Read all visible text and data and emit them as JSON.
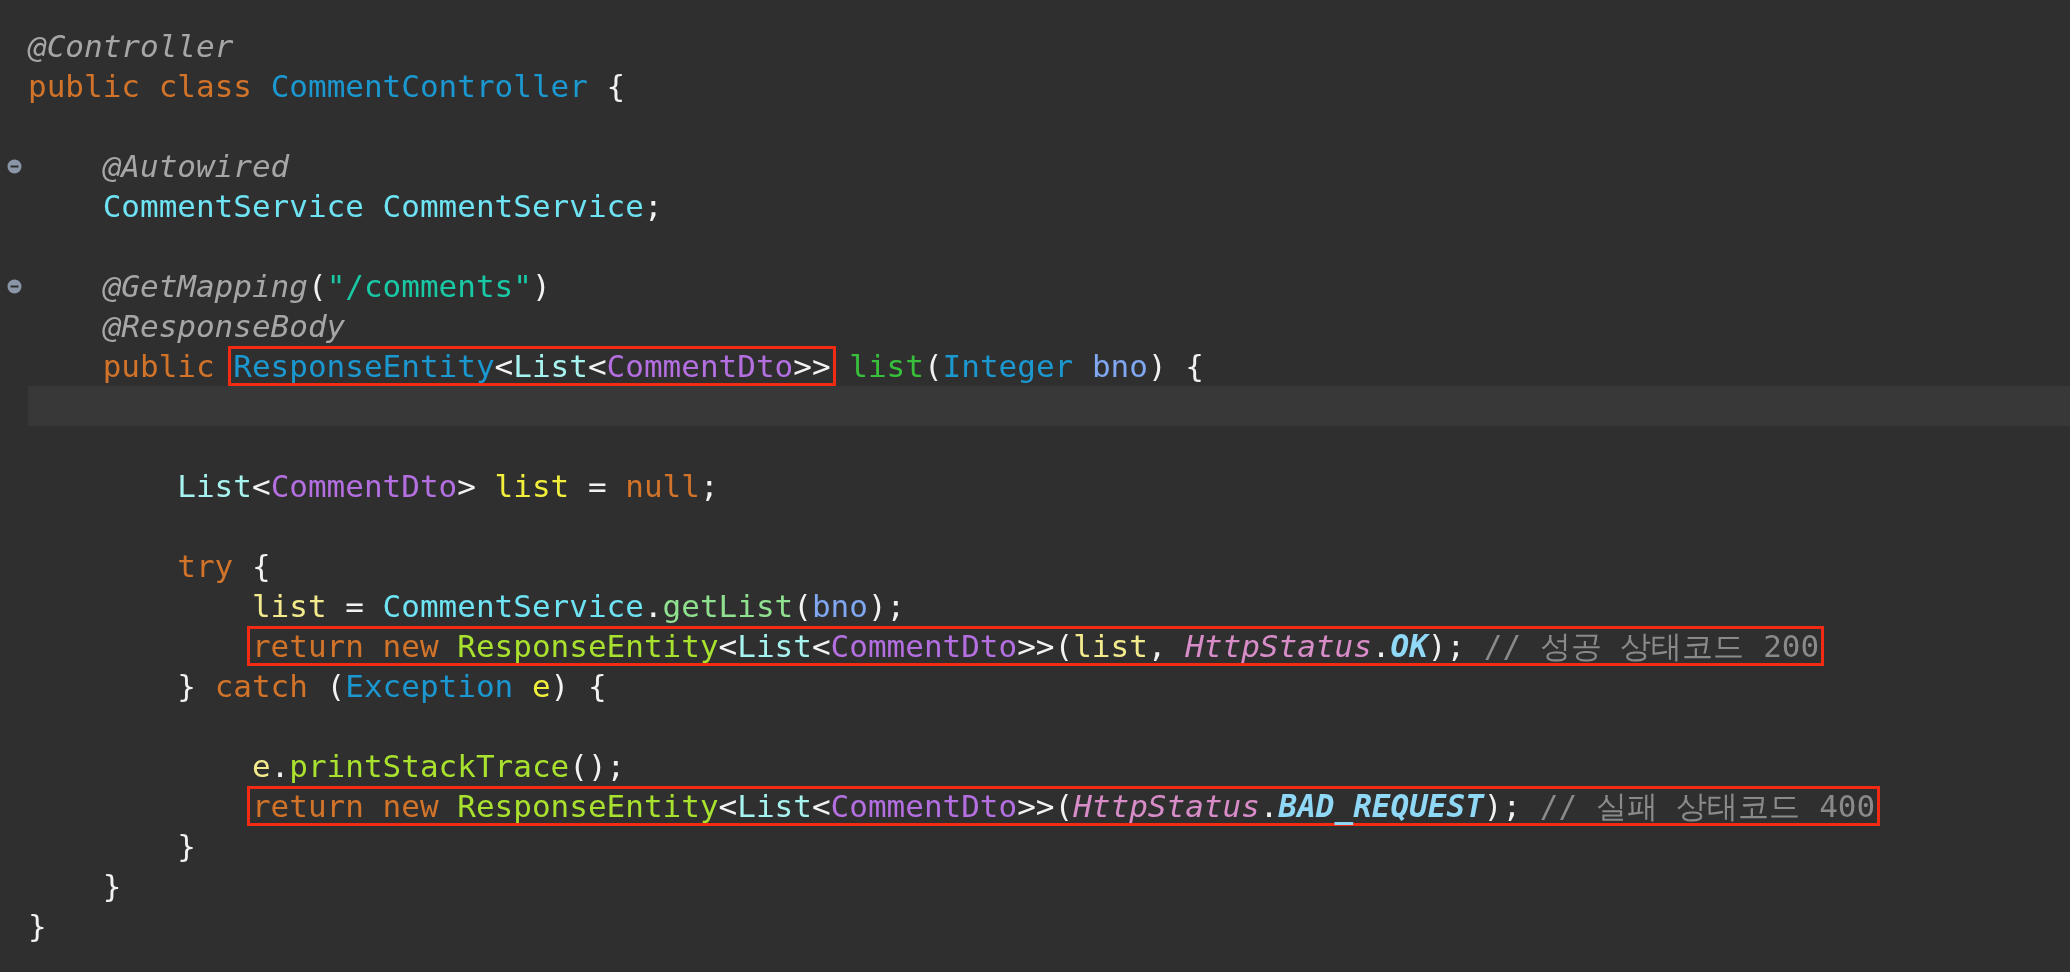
{
  "editor": {
    "lines": [
      {
        "kind": "code",
        "tokens": [
          {
            "kind": "annotation",
            "text": "@Controller"
          }
        ]
      },
      {
        "kind": "code",
        "tokens": [
          {
            "kind": "keyword",
            "text": "public class "
          },
          {
            "kind": "class",
            "text": "CommentController"
          },
          {
            "kind": "plain",
            "text": " {"
          }
        ],
        "children": [
          {
            "kind": "blank"
          },
          {
            "kind": "code",
            "folding": true,
            "tokens": [
              {
                "kind": "annotation",
                "text": "@Autowired"
              }
            ]
          },
          {
            "kind": "code",
            "tokens": [
              {
                "kind": "field_type",
                "text": "CommentService CommentService"
              },
              {
                "kind": "plain",
                "text": ";"
              }
            ]
          },
          {
            "kind": "blank"
          },
          {
            "kind": "code",
            "folding": true,
            "tokens": [
              {
                "kind": "annotation",
                "text": "@GetMapping"
              },
              {
                "kind": "plain",
                "text": "("
              },
              {
                "kind": "string",
                "text": "\"/comments\""
              },
              {
                "kind": "plain",
                "text": ")"
              }
            ]
          },
          {
            "kind": "code",
            "tokens": [
              {
                "kind": "annotation",
                "text": "@ResponseBody"
              }
            ]
          },
          {
            "kind": "code",
            "tokens": [
              {
                "kind": "keyword",
                "text": "public "
              },
              {
                "kind": "marked",
                "tokens": [
                  {
                    "kind": "class",
                    "text": "ResponseEntity"
                  },
                  {
                    "kind": "plain",
                    "text": "<"
                  },
                  {
                    "kind": "type",
                    "text": "List"
                  },
                  {
                    "kind": "plain",
                    "text": "<"
                  },
                  {
                    "kind": "dto",
                    "text": "CommentDto"
                  },
                  {
                    "kind": "plain",
                    "text": ">>"
                  }
                ]
              },
              {
                "kind": "method_decl",
                "text": " list"
              },
              {
                "kind": "plain",
                "text": "("
              },
              {
                "kind": "class",
                "text": "Integer "
              },
              {
                "kind": "param",
                "text": "bno"
              },
              {
                "kind": "plain",
                "text": ") {"
              }
            ],
            "children": [
              {
                "kind": "blank",
                "current": true
              },
              {
                "kind": "blank"
              },
              {
                "kind": "code",
                "tokens": [
                  {
                    "kind": "type",
                    "text": "List"
                  },
                  {
                    "kind": "plain",
                    "text": "<"
                  },
                  {
                    "kind": "dto",
                    "text": "CommentDto"
                  },
                  {
                    "kind": "plain",
                    "text": "> "
                  },
                  {
                    "kind": "var",
                    "text": "list"
                  },
                  {
                    "kind": "plain",
                    "text": " = "
                  },
                  {
                    "kind": "keyword",
                    "text": "null"
                  },
                  {
                    "kind": "plain",
                    "text": ";"
                  }
                ]
              },
              {
                "kind": "blank"
              },
              {
                "kind": "code",
                "tokens": [
                  {
                    "kind": "keyword",
                    "text": "try"
                  },
                  {
                    "kind": "plain",
                    "text": " {"
                  }
                ],
                "children": [
                  {
                    "kind": "code",
                    "tokens": [
                      {
                        "kind": "local",
                        "text": "list"
                      },
                      {
                        "kind": "plain",
                        "text": " = "
                      },
                      {
                        "kind": "field_type",
                        "text": "CommentService"
                      },
                      {
                        "kind": "plain",
                        "text": "."
                      },
                      {
                        "kind": "method",
                        "text": "getList"
                      },
                      {
                        "kind": "plain",
                        "text": "("
                      },
                      {
                        "kind": "param",
                        "text": "bno"
                      },
                      {
                        "kind": "plain",
                        "text": ");"
                      }
                    ]
                  },
                  {
                    "kind": "code",
                    "tokens": [
                      {
                        "kind": "marked",
                        "tokens": [
                          {
                            "kind": "keyword",
                            "text": "return new "
                          },
                          {
                            "kind": "call",
                            "text": "ResponseEntity"
                          },
                          {
                            "kind": "plain",
                            "text": "<"
                          },
                          {
                            "kind": "type",
                            "text": "List"
                          },
                          {
                            "kind": "plain",
                            "text": "<"
                          },
                          {
                            "kind": "dto",
                            "text": "CommentDto"
                          },
                          {
                            "kind": "plain",
                            "text": ">>("
                          },
                          {
                            "kind": "local",
                            "text": "list"
                          },
                          {
                            "kind": "plain",
                            "text": ", "
                          },
                          {
                            "kind": "static_class",
                            "text": "HttpStatus"
                          },
                          {
                            "kind": "plain",
                            "text": "."
                          },
                          {
                            "kind": "constant",
                            "text": "OK"
                          },
                          {
                            "kind": "plain",
                            "text": "); "
                          },
                          {
                            "kind": "comment",
                            "text": "// 성공 상태코드 200"
                          }
                        ]
                      }
                    ]
                  }
                ]
              },
              {
                "kind": "code",
                "tokens": [
                  {
                    "kind": "plain",
                    "text": "} "
                  },
                  {
                    "kind": "keyword",
                    "text": "catch"
                  },
                  {
                    "kind": "plain",
                    "text": " ("
                  },
                  {
                    "kind": "class",
                    "text": "Exception "
                  },
                  {
                    "kind": "var",
                    "text": "e"
                  },
                  {
                    "kind": "plain",
                    "text": ") {"
                  }
                ],
                "children": [
                  {
                    "kind": "blank"
                  },
                  {
                    "kind": "code",
                    "tokens": [
                      {
                        "kind": "local",
                        "text": "e"
                      },
                      {
                        "kind": "plain",
                        "text": "."
                      },
                      {
                        "kind": "call",
                        "text": "printStackTrace"
                      },
                      {
                        "kind": "plain",
                        "text": "();"
                      }
                    ]
                  },
                  {
                    "kind": "code",
                    "tokens": [
                      {
                        "kind": "marked",
                        "tokens": [
                          {
                            "kind": "keyword",
                            "text": "return new "
                          },
                          {
                            "kind": "call",
                            "text": "ResponseEntity"
                          },
                          {
                            "kind": "plain",
                            "text": "<"
                          },
                          {
                            "kind": "type",
                            "text": "List"
                          },
                          {
                            "kind": "plain",
                            "text": "<"
                          },
                          {
                            "kind": "dto",
                            "text": "CommentDto"
                          },
                          {
                            "kind": "plain",
                            "text": ">>("
                          },
                          {
                            "kind": "static_class",
                            "text": "HttpStatus"
                          },
                          {
                            "kind": "plain",
                            "text": "."
                          },
                          {
                            "kind": "constant",
                            "text": "BAD_REQUEST"
                          },
                          {
                            "kind": "plain",
                            "text": "); "
                          },
                          {
                            "kind": "comment",
                            "text": "// 실패 상태코드 400"
                          }
                        ]
                      }
                    ]
                  }
                ]
              },
              {
                "kind": "code",
                "tokens": [
                  {
                    "kind": "plain",
                    "text": "}"
                  }
                ]
              }
            ]
          },
          {
            "kind": "code",
            "tokens": [
              {
                "kind": "plain",
                "text": "}"
              }
            ]
          }
        ]
      },
      {
        "kind": "code",
        "tokens": [
          {
            "kind": "plain",
            "text": "}"
          }
        ]
      }
    ]
  }
}
